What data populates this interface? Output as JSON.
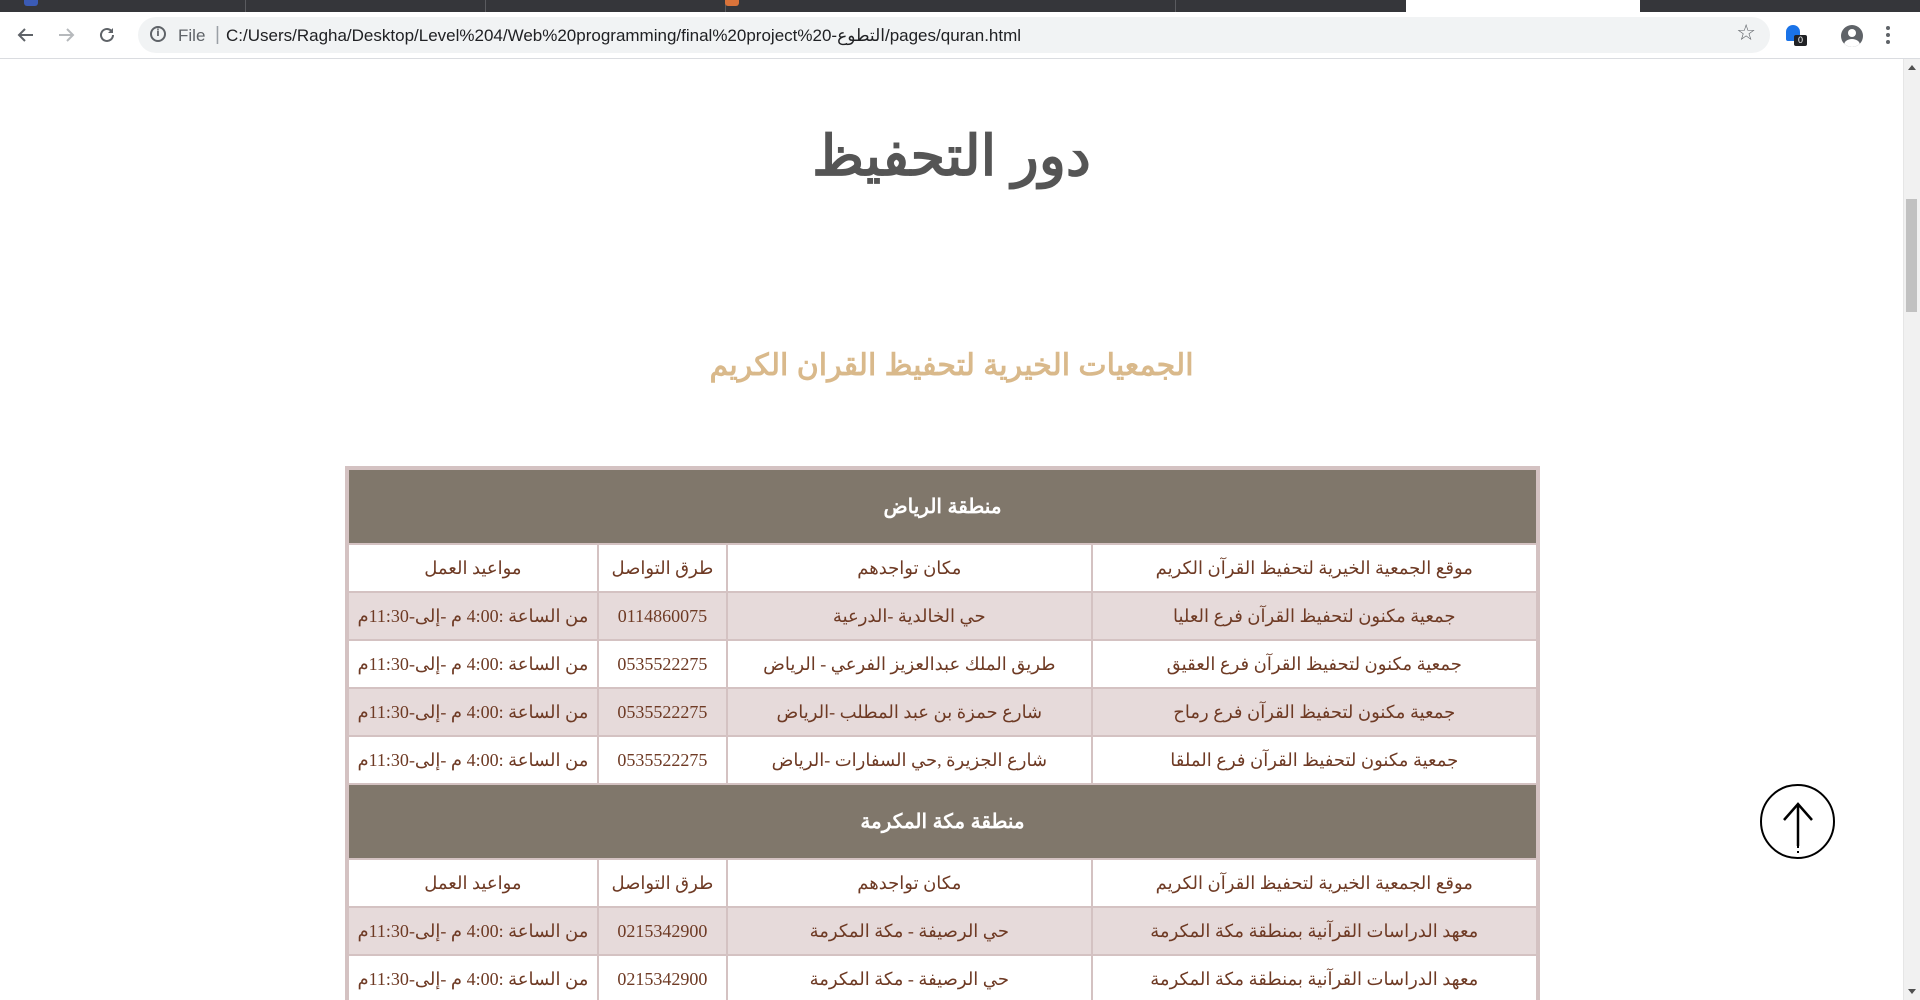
{
  "browser": {
    "url_scheme": "File",
    "url_path": "C:/Users/Ragha/Desktop/Level%204/Web%20programming/final%20project%20-التطوع/pages/quran.html",
    "extension_badge": "0"
  },
  "page": {
    "title": "دور التحفيظ",
    "section_title": "الجمعيات الخيرية لتحفيظ القران الكريم",
    "title_color": "#555555",
    "section_title_color": "#d9b98b",
    "region_header_bg": "#80776b",
    "row_shade_bg": "#e6dada",
    "cell_text_color": "#6e3a24"
  },
  "table": {
    "columns": [
      "موقع الجمعية الخيرية لتحفيظ القرآن الكريم",
      "مكان تواجدهم",
      "طرق التواصل",
      "مواعيد العمل"
    ],
    "regions": [
      {
        "name": "منطقة الرياض",
        "rows": [
          {
            "name": "جمعية مكنون لتحفيظ القرآن فرع العليا",
            "location": "حي الخالدية -الدرعية",
            "contact": "0114860075",
            "hours": "من الساعة :4:00 م -إلى-11:30م"
          },
          {
            "name": "جمعية مكنون لتحفيظ القرآن فرع العقيق",
            "location": "طريق الملك عبدالعزيز الفرعي - الرياض",
            "contact": "0535522275",
            "hours": "من الساعة :4:00 م -إلى-11:30م"
          },
          {
            "name": "جمعية مكنون لتحفيظ القرآن فرع رماح",
            "location": "شارع حمزة بن عبد المطلب -الرياض",
            "contact": "0535522275",
            "hours": "من الساعة :4:00 م -إلى-11:30م"
          },
          {
            "name": "جمعية مكنون لتحفيظ القرآن فرع الملقا",
            "location": "شارع الجزيرة ,حي السفارات -الرياض",
            "contact": "0535522275",
            "hours": "من الساعة :4:00 م -إلى-11:30م"
          }
        ]
      },
      {
        "name": "منطقة مكة المكرمة",
        "rows": [
          {
            "name": "معهد الدراسات القرآنية بمنطقة مكة المكرمة",
            "location": "حي الرصيفة - مكة المكرمة",
            "contact": "0215342900",
            "hours": "من الساعة :4:00 م -إلى-11:30م"
          },
          {
            "name": "معهد الدراسات القرآنية بمنطقة مكة المكرمة",
            "location": "حي الرصيفة - مكة المكرمة",
            "contact": "0215342900",
            "hours": "من الساعة :4:00 م -إلى-11:30م"
          }
        ]
      }
    ]
  },
  "icons": {
    "back": "arrow-left-icon",
    "forward": "arrow-right-icon",
    "reload": "reload-icon",
    "info": "info-icon",
    "bookmark": "star-icon",
    "extension": "extension-icon",
    "profile": "profile-icon",
    "menu": "kebab-menu-icon",
    "scroll_top": "arrow-up-icon"
  }
}
